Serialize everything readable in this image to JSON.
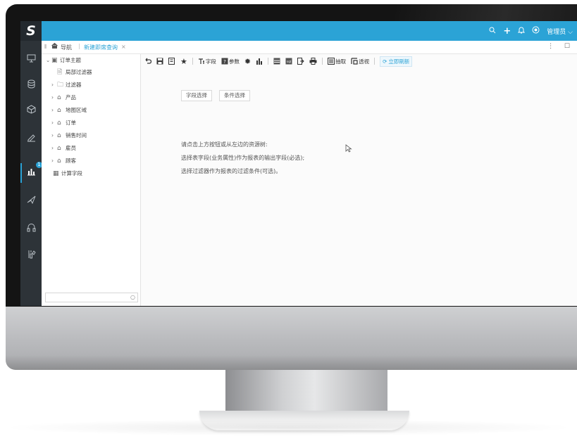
{
  "app": {
    "logo": "S",
    "top_icons": [
      "search-icon",
      "plus-icon",
      "bell-icon",
      "theme-icon"
    ],
    "user_label": "管理员"
  },
  "tabs": {
    "home_label": "导航",
    "active_tab": "新建即席查询",
    "close": "×"
  },
  "window": {
    "controls": "⋮ ☐"
  },
  "tree": {
    "root": "订单主题",
    "items": [
      {
        "label": "局部过滤器",
        "icon": "filter-doc-icon",
        "caret": ""
      },
      {
        "label": "过滤器",
        "icon": "folder-icon",
        "caret": "›"
      },
      {
        "label": "产品",
        "icon": "table-icon",
        "caret": "›"
      },
      {
        "label": "地图区域",
        "icon": "table-icon",
        "caret": "›"
      },
      {
        "label": "订单",
        "icon": "table-icon",
        "caret": "›"
      },
      {
        "label": "销售时间",
        "icon": "table-icon",
        "caret": "›"
      },
      {
        "label": "雇员",
        "icon": "table-icon",
        "caret": "›"
      },
      {
        "label": "顾客",
        "icon": "table-icon",
        "caret": "›"
      },
      {
        "label": "计算字段",
        "icon": "calc-icon",
        "caret": ""
      }
    ],
    "search_placeholder": ""
  },
  "toolbar": {
    "field_label": "字段",
    "param_label": "参数",
    "extract_label": "抽取",
    "pivot_label": "透视",
    "refresh_label": "立即刷新"
  },
  "content": {
    "field_select": "字段选择",
    "condition_select": "条件选择",
    "hints": [
      "请点击上方按钮或从左边的资源树:",
      "选择表字段(业务属性)作为报表的输出字段(必选);",
      "选择过滤器作为报表的过滤条件(可选)。"
    ]
  },
  "colors": {
    "accent": "#2ba3d6",
    "rail": "#2d3338"
  },
  "badge": "1"
}
